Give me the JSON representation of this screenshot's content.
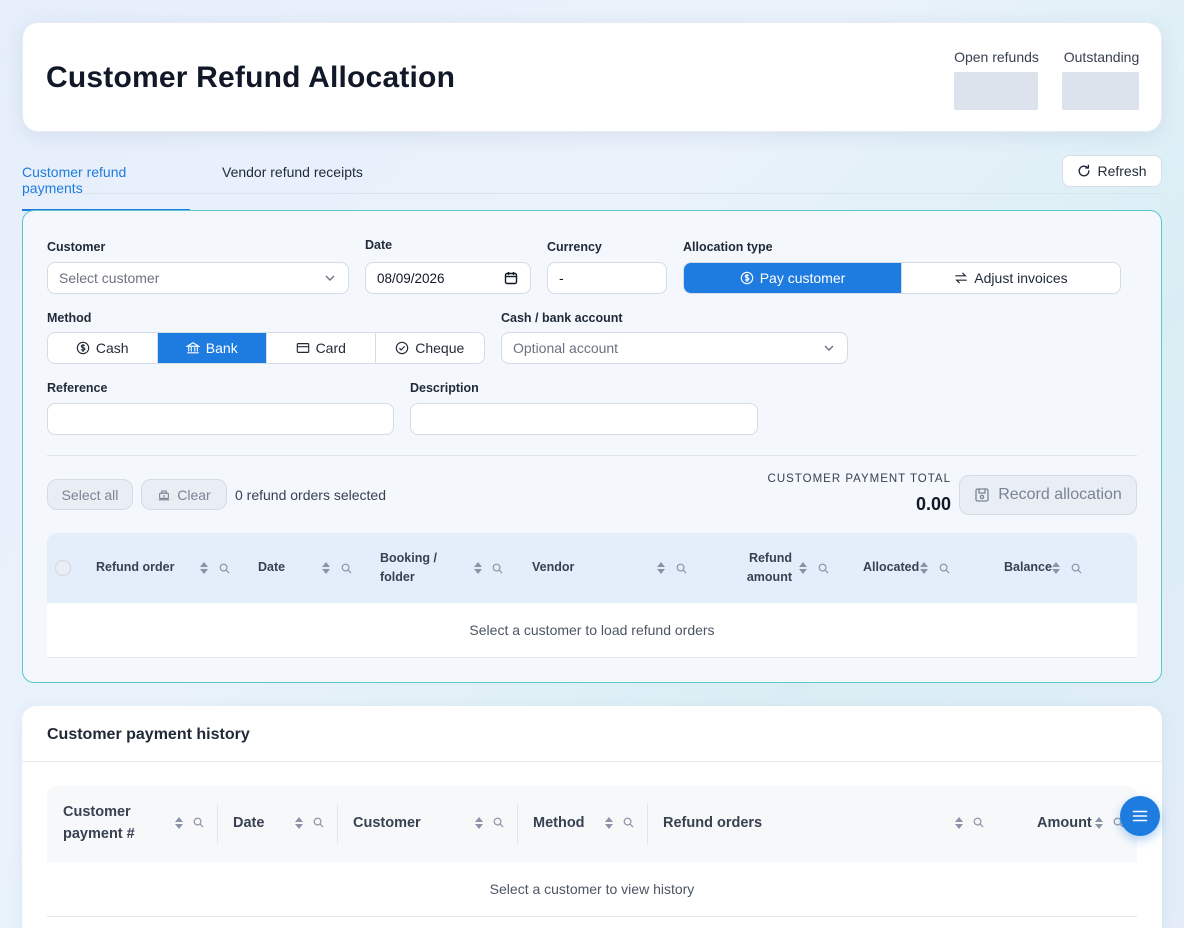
{
  "header": {
    "title": "Customer Refund Allocation",
    "stats": {
      "open_refunds_label": "Open refunds",
      "outstanding_label": "Outstanding"
    }
  },
  "tabs": [
    {
      "label": "Customer refund payments",
      "active": true
    },
    {
      "label": "Vendor refund receipts",
      "active": false
    }
  ],
  "refresh_label": "Refresh",
  "form": {
    "customer": {
      "label": "Customer",
      "placeholder": "Select customer"
    },
    "date": {
      "label": "Date",
      "value": "08/09/2026"
    },
    "currency": {
      "label": "Currency",
      "value": "-"
    },
    "allocation_type": {
      "label": "Allocation type",
      "options": [
        "Pay customer",
        "Adjust invoices"
      ],
      "selected": "Pay customer"
    },
    "method": {
      "label": "Method",
      "options": [
        "Cash",
        "Bank",
        "Card",
        "Cheque"
      ],
      "selected": "Bank"
    },
    "account": {
      "label": "Cash / bank account",
      "placeholder": "Optional account"
    },
    "reference": {
      "label": "Reference",
      "value": ""
    },
    "description": {
      "label": "Description",
      "value": ""
    }
  },
  "actions": {
    "select_all": "Select all",
    "clear": "Clear",
    "selected_count": "0 refund orders selected",
    "total_label": "CUSTOMER PAYMENT TOTAL",
    "total_value": "0.00",
    "record": "Record allocation"
  },
  "refund_table": {
    "columns": [
      "Refund order",
      "Date",
      "Booking / folder",
      "Vendor",
      "Refund amount",
      "Allocated",
      "Balance"
    ],
    "empty": "Select a customer to load refund orders"
  },
  "history": {
    "title": "Customer payment history",
    "columns": [
      "Customer payment #",
      "Date",
      "Customer",
      "Method",
      "Refund orders",
      "Amount"
    ],
    "empty": "Select a customer to view history"
  },
  "colors": {
    "primary": "#1e7be0",
    "accent_border": "#5cc7d1"
  }
}
